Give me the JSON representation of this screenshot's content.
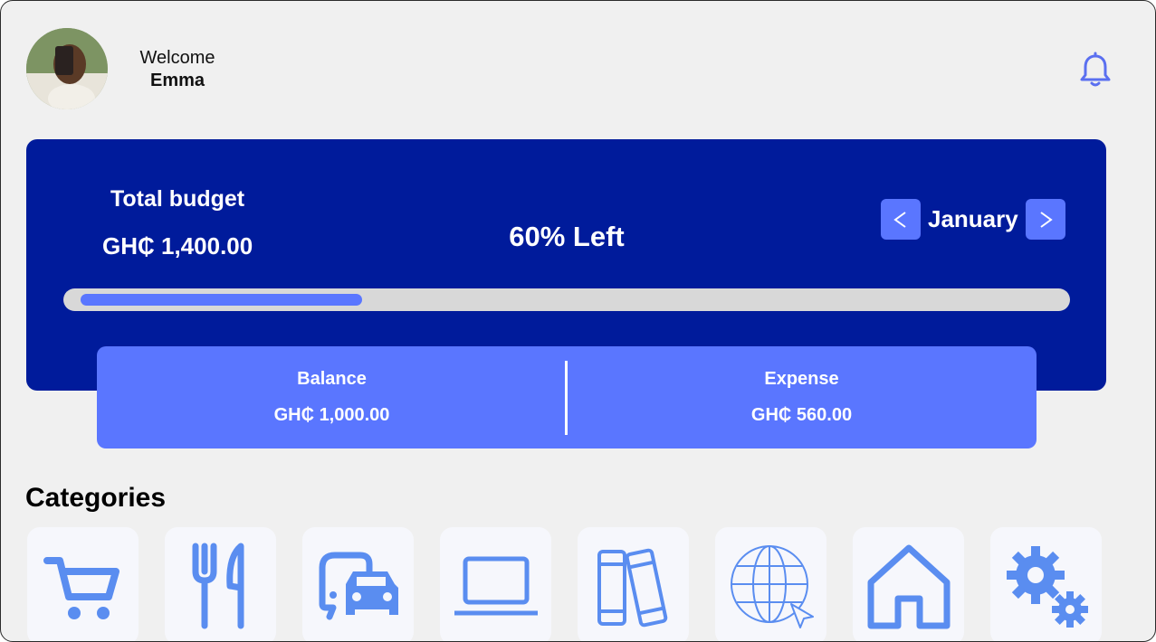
{
  "header": {
    "greeting": "Welcome",
    "user_name": "Emma",
    "avatar_icon": "user-avatar-photo",
    "notification_icon": "bell-icon"
  },
  "budget": {
    "total_label": "Total budget",
    "total_amount": "GH₵ 1,400.00",
    "remaining_text": "60% Left",
    "month": "January",
    "prev_icon": "chevron-left-icon",
    "next_icon": "chevron-right-icon",
    "progress_fraction": 0.29
  },
  "summary": {
    "balance_label": "Balance",
    "balance_amount": "GH₵ 1,000.00",
    "expense_label": "Expense",
    "expense_amount": "GH₵ 560.00"
  },
  "categories": {
    "title": "Categories",
    "items": [
      {
        "icon": "shopping-cart-icon"
      },
      {
        "icon": "fork-knife-icon"
      },
      {
        "icon": "transport-icon"
      },
      {
        "icon": "laptop-icon"
      },
      {
        "icon": "books-icon"
      },
      {
        "icon": "globe-cursor-icon"
      },
      {
        "icon": "home-icon"
      },
      {
        "icon": "settings-gears-icon"
      }
    ]
  },
  "colors": {
    "hero_bg": "#001b9b",
    "accent": "#5a76ff",
    "page_bg": "#f0f0f0",
    "icon_blue": "#5a8df0"
  }
}
